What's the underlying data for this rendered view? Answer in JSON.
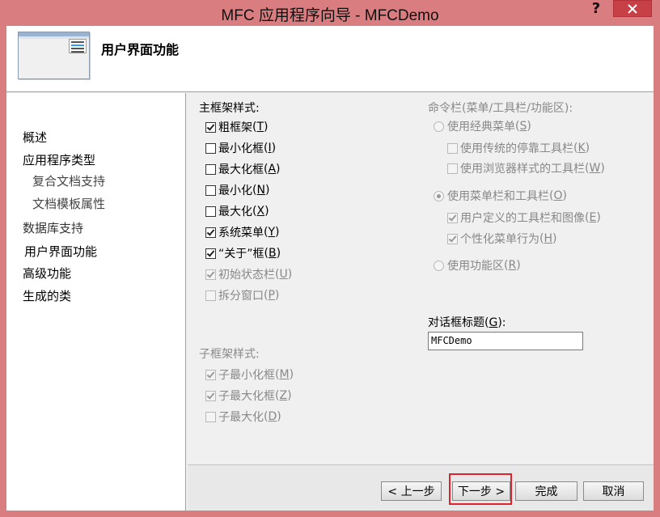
{
  "window": {
    "title": "MFC 应用程序向导 - MFCDemo",
    "help": "?"
  },
  "header": {
    "title": "用户界面功能"
  },
  "sidebar": {
    "items": [
      {
        "label": "概述"
      },
      {
        "label": "应用程序类型"
      },
      {
        "label": "复合文档支持"
      },
      {
        "label": "文档模板属性"
      },
      {
        "label": "数据库支持"
      },
      {
        "label": "用户界面功能"
      },
      {
        "label": "高级功能"
      },
      {
        "label": "生成的类"
      }
    ]
  },
  "main_frame": {
    "heading": "主框架样式:",
    "options": [
      {
        "label": "粗框架",
        "key": "T",
        "checked": true,
        "enabled": true
      },
      {
        "label": "最小化框",
        "key": "I",
        "checked": false,
        "enabled": true
      },
      {
        "label": "最大化框",
        "key": "A",
        "checked": false,
        "enabled": true
      },
      {
        "label": "最小化",
        "key": "N",
        "checked": false,
        "enabled": true
      },
      {
        "label": "最大化",
        "key": "X",
        "checked": false,
        "enabled": true
      },
      {
        "label": "系统菜单",
        "key": "Y",
        "checked": true,
        "enabled": true
      },
      {
        "label": "“关于”框",
        "key": "B",
        "checked": true,
        "enabled": true
      },
      {
        "label": "初始状态栏",
        "key": "U",
        "checked": true,
        "enabled": false
      },
      {
        "label": "拆分窗口",
        "key": "P",
        "checked": false,
        "enabled": false
      }
    ]
  },
  "child_frame": {
    "heading": "子框架样式:",
    "options": [
      {
        "label": "子最小化框",
        "key": "M",
        "checked": true,
        "enabled": false
      },
      {
        "label": "子最大化框",
        "key": "Z",
        "checked": true,
        "enabled": false
      },
      {
        "label": "子最大化",
        "key": "D",
        "checked": false,
        "enabled": false
      }
    ]
  },
  "command_bar": {
    "heading": "命令栏(菜单/工具栏/功能区):",
    "classic_menu": {
      "label": "使用经典菜单",
      "key": "S",
      "selected": false
    },
    "legacy_toolbar": {
      "label": "使用传统的停靠工具栏",
      "key": "K",
      "checked": false
    },
    "browser_toolbar": {
      "label": "使用浏览器样式的工具栏",
      "key": "W",
      "checked": false
    },
    "menu_and_toolbar": {
      "label": "使用菜单栏和工具栏",
      "key": "O",
      "selected": true
    },
    "user_toolbar": {
      "label": "用户定义的工具栏和图像",
      "key": "E",
      "checked": true
    },
    "personalized_menu": {
      "label": "个性化菜单行为",
      "key": "H",
      "checked": true
    },
    "ribbon": {
      "label": "使用功能区",
      "key": "R",
      "selected": false
    }
  },
  "dialog_title": {
    "label": "对话框标题",
    "key": "G",
    "suffix": ":",
    "value": "MFCDemo"
  },
  "footer": {
    "prev": "< 上一步",
    "next": "下一步 >",
    "finish": "完成",
    "cancel": "取消"
  },
  "colors": {
    "titlebar": "#d97d80",
    "close_button": "#c74046",
    "highlight": "#e0232b"
  }
}
